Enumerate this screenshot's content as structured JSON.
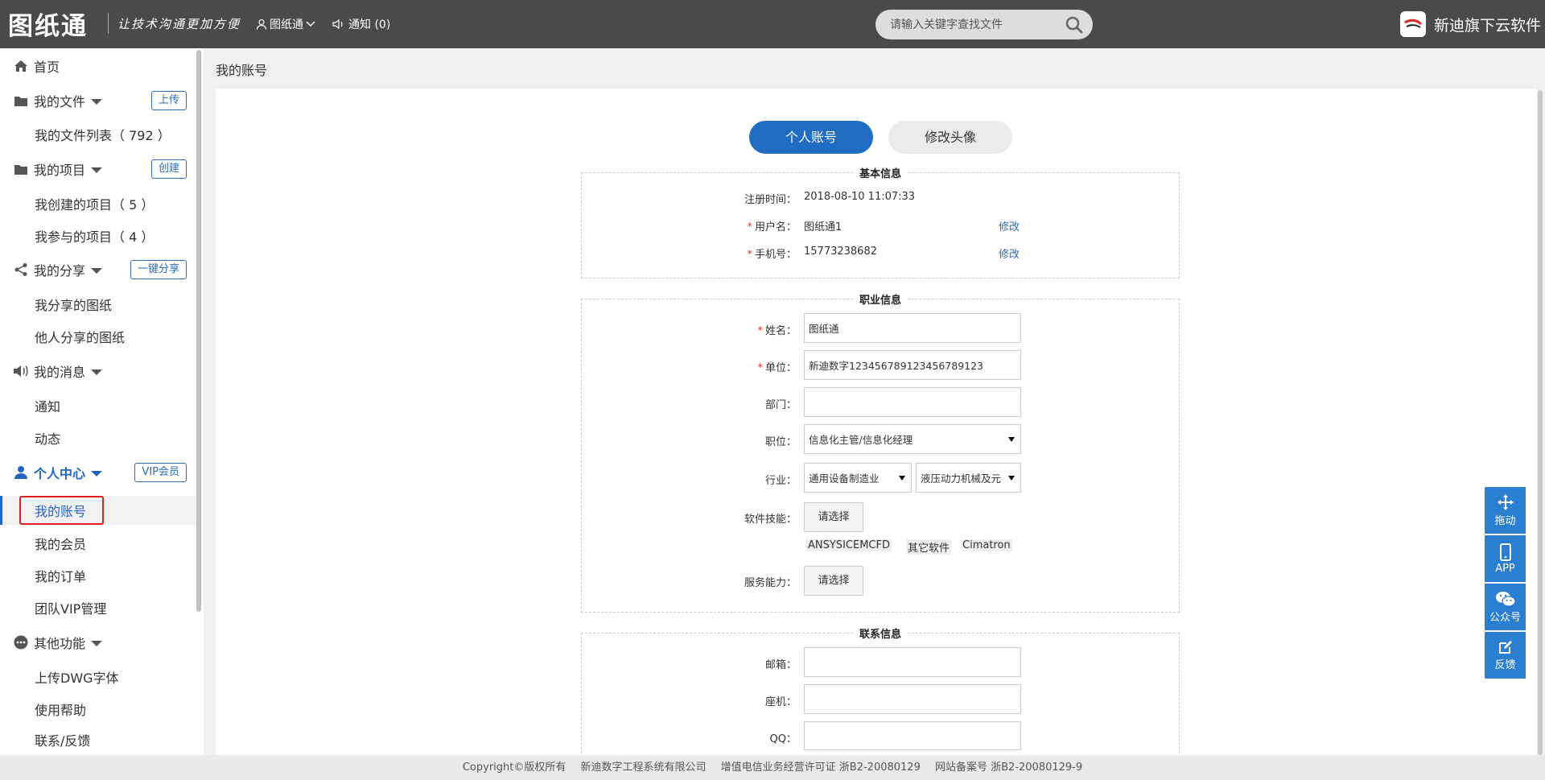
{
  "app": {
    "logo": "图纸通",
    "slogan": "让技术沟通更加方便",
    "user": "图纸通",
    "notice": "通知 (0)",
    "search_placeholder": "请输入关键字查找文件",
    "brand": "新迪旗下云软件"
  },
  "sidebar": {
    "home": "首页",
    "my_files": "我的文件",
    "upload_btn": "上传",
    "file_list": "我的文件列表（ 792 ）",
    "my_projects": "我的项目",
    "create_btn": "创建",
    "created_projects": "我创建的项目（ 5 ）",
    "joined_projects": "我参与的项目（ 4 ）",
    "my_share": "我的分享",
    "share_btn": "一键分享",
    "my_shared": "我分享的图纸",
    "others_shared": "他人分享的图纸",
    "my_messages": "我的消息",
    "notice": "通知",
    "activity": "动态",
    "personal_center": "个人中心",
    "vip_btn": "VIP会员",
    "my_account": "我的账号",
    "my_membership": "我的会员",
    "my_orders": "我的订单",
    "team_vip": "团队VIP管理",
    "other_functions": "其他功能",
    "upload_font": "上传DWG字体",
    "help": "使用帮助",
    "contact": "联系/反馈"
  },
  "breadcrumb": "我的账号",
  "tabs": {
    "account": "个人账号",
    "avatar": "修改头像"
  },
  "basic": {
    "title": "基本信息",
    "reg_label": "注册时间：",
    "reg_value": "2018-08-10 11:07:33",
    "user_label": "用户名：",
    "user_value": "图纸通1",
    "phone_label": "手机号：",
    "phone_value": "15773238682",
    "edit": "修改"
  },
  "career": {
    "title": "职业信息",
    "name_label": "姓名：",
    "name_value": "图纸通",
    "company_label": "单位：",
    "company_value": "新迪数字123456789123456789123",
    "dept_label": "部门：",
    "dept_value": "",
    "position_label": "职位：",
    "position_value": "信息化主管/信息化经理",
    "industry_label": "行业：",
    "industry_value1": "通用设备制造业",
    "industry_value2": "液压动力机械及元",
    "skills_label": "软件技能：",
    "pick": "请选择",
    "skill_tags": [
      "ANSYSICEMCFD",
      "其它软件",
      "Cimatron"
    ],
    "service_label": "服务能力："
  },
  "contact": {
    "title": "联系信息",
    "email_label": "邮箱：",
    "landline_label": "座机：",
    "qq_label": "QQ："
  },
  "footer": {
    "copyright": "Copyright©版权所有",
    "company": "新迪数字工程系统有限公司",
    "license": "增值电信业务经营许可证  浙B2-20080129",
    "icp": "网站备案号  浙B2-20080129-9"
  },
  "float": {
    "drag": "拖动",
    "app": "APP",
    "wechat": "公众号",
    "feedback": "反馈"
  },
  "colors": {
    "topbar": "#4a4a4a",
    "accent": "#1f6cc2",
    "float": "#2b7fd0",
    "active_outline": "#e02020"
  }
}
